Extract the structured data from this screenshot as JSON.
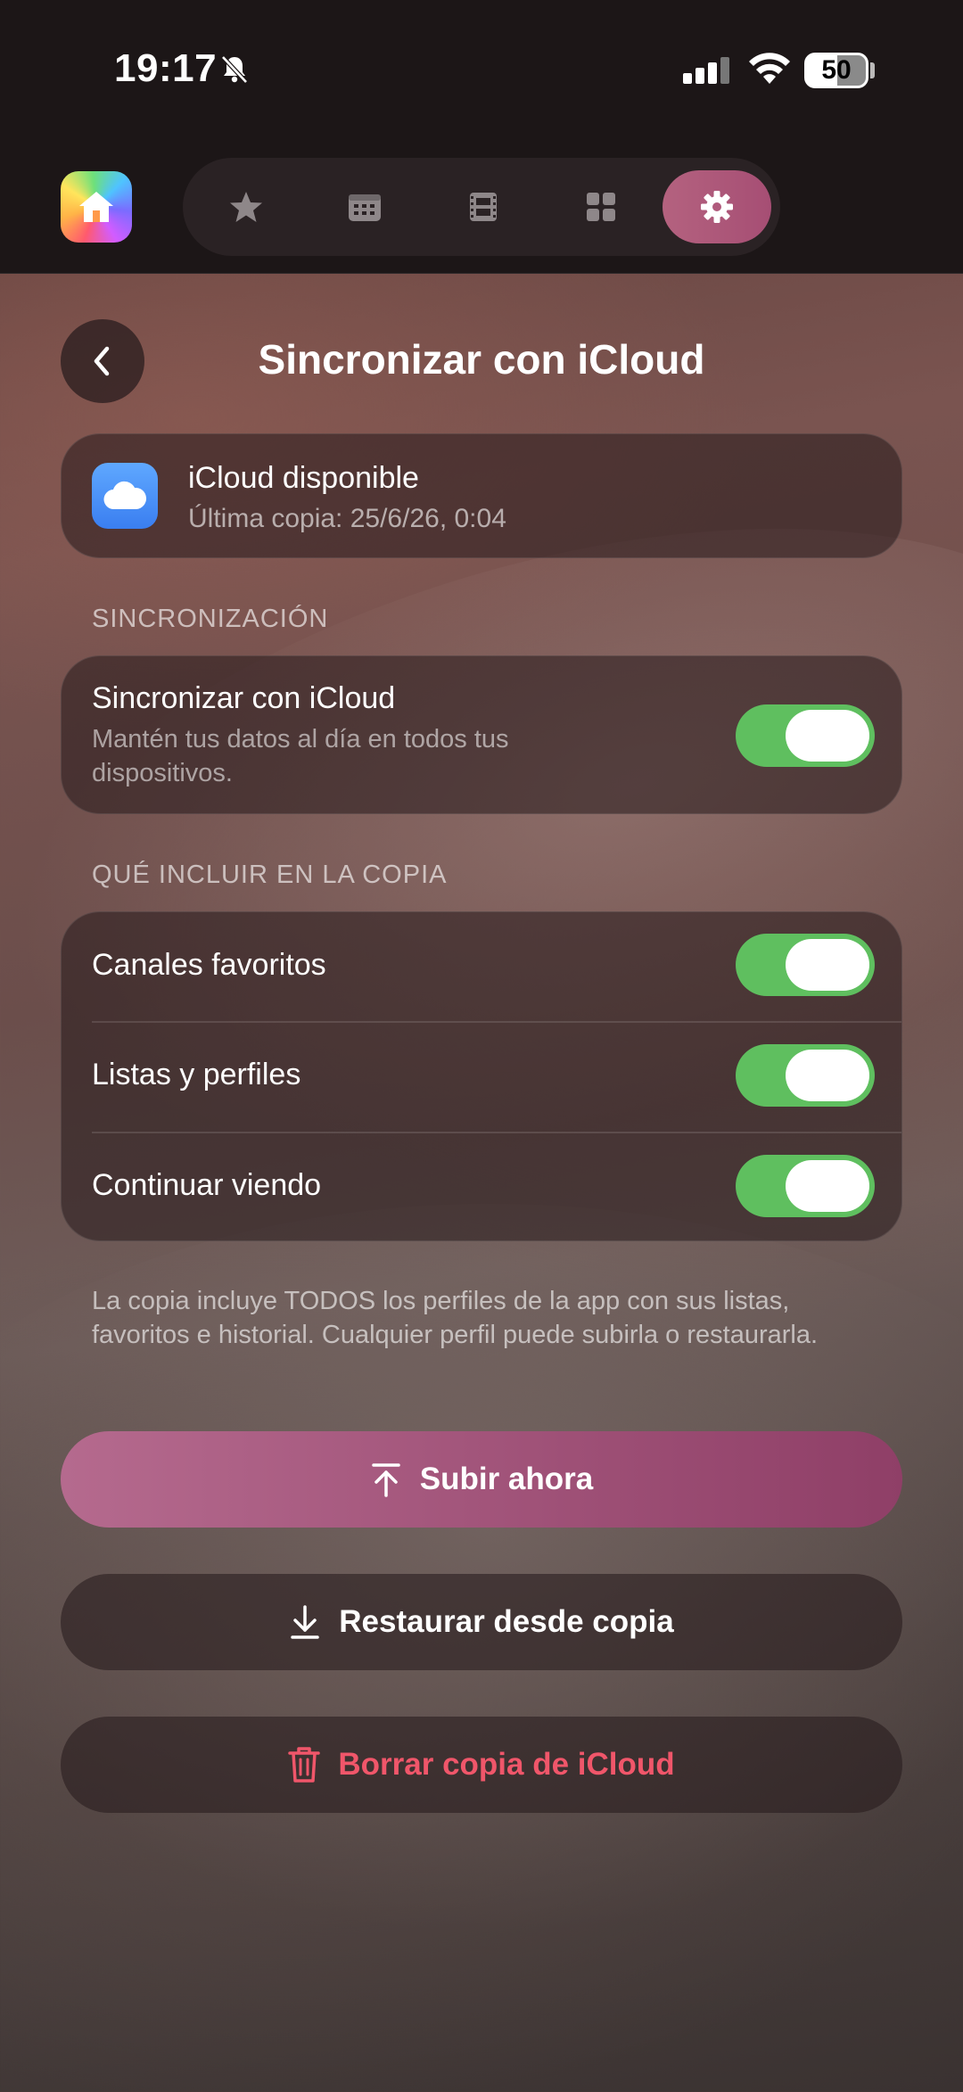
{
  "status_bar": {
    "time": "19:17",
    "battery": "50",
    "icons": [
      "bell-slash-icon",
      "cellular-signal-icon",
      "wifi-icon",
      "battery-icon"
    ]
  },
  "nav": {
    "items": [
      "home-icon",
      "star-icon",
      "calendar-icon",
      "film-icon",
      "grid-icon",
      "gear-icon"
    ],
    "active": "gear-icon",
    "accent": "#b4627f"
  },
  "header": {
    "title": "Sincronizar con iCloud"
  },
  "status": {
    "title": "iCloud disponible",
    "subtitle": "Última copia: 25/6/26, 0:04"
  },
  "sync_section": {
    "label": "SINCRONIZACIÓN",
    "title": "Sincronizar con iCloud",
    "description": "Mantén tus datos al día en todos tus dispositivos.",
    "enabled": true
  },
  "include_section": {
    "label": "QUÉ INCLUIR EN LA COPIA",
    "items": [
      {
        "label": "Canales favoritos",
        "enabled": true
      },
      {
        "label": "Listas y perfiles",
        "enabled": true
      },
      {
        "label": "Continuar viendo",
        "enabled": true
      }
    ]
  },
  "footnote": "La copia incluye TODOS los perfiles de la app con sus listas, favoritos e historial. Cualquier perfil puede subirla o restaurarla.",
  "actions": {
    "upload": "Subir ahora",
    "restore": "Restaurar desde copia",
    "delete": "Borrar copia de iCloud"
  },
  "colors": {
    "toggle_on": "#5fbf5f",
    "primary_button": "#a64e74",
    "destructive": "#f0566a"
  }
}
